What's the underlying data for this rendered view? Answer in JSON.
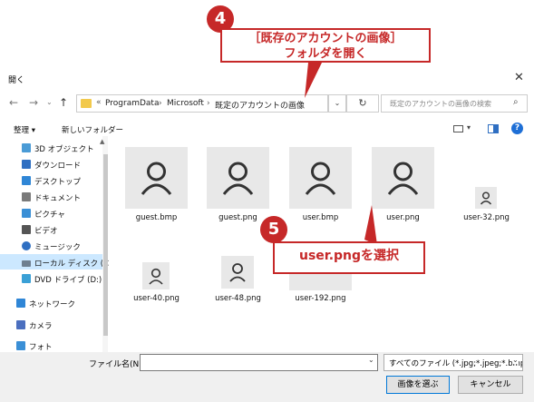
{
  "window": {
    "title": "開く"
  },
  "address": {
    "chevrons": "«",
    "segments": [
      "ProgramData",
      "Microsoft",
      "既定のアカウントの画像"
    ],
    "separator": "›"
  },
  "search": {
    "placeholder": "既定のアカウントの画像の検索"
  },
  "toolbar": {
    "organize": "整理 ▾",
    "new_folder": "新しいフォルダー"
  },
  "sidebar": {
    "items": [
      {
        "label": "3D オブジェクト",
        "icon": "cube-icon",
        "color": "#4a9bd6"
      },
      {
        "label": "ダウンロード",
        "icon": "download-icon",
        "color": "#2f6fc2"
      },
      {
        "label": "デスクトップ",
        "icon": "desktop-icon",
        "color": "#2f86d6"
      },
      {
        "label": "ドキュメント",
        "icon": "document-icon",
        "color": "#7a7a7a"
      },
      {
        "label": "ピクチャ",
        "icon": "pictures-icon",
        "color": "#3a8fd6"
      },
      {
        "label": "ビデオ",
        "icon": "video-icon",
        "color": "#555555"
      },
      {
        "label": "ミュージック",
        "icon": "music-icon",
        "color": "#2f6fc2"
      },
      {
        "label": "ローカル ディスク (C",
        "icon": "disk-icon",
        "color": "#6f7f8f"
      },
      {
        "label": "DVD ドライブ (D:)",
        "icon": "dvd-icon",
        "color": "#3aa0d6"
      },
      {
        "label": "ネットワーク",
        "icon": "network-icon",
        "color": "#2f86d6"
      },
      {
        "label": "カメラ",
        "icon": "camera-icon",
        "color": "#4b6fbf"
      },
      {
        "label": "フォト",
        "icon": "photo-icon",
        "color": "#3a8fd6"
      }
    ]
  },
  "files": [
    {
      "name": "guest.bmp"
    },
    {
      "name": "guest.png"
    },
    {
      "name": "user.bmp"
    },
    {
      "name": "user.png"
    },
    {
      "name": "user-32.png"
    },
    {
      "name": "user-40.png"
    },
    {
      "name": "user-48.png"
    },
    {
      "name": "user-192.png"
    }
  ],
  "bottom": {
    "filename_label": "ファイル名(N):",
    "filename_value": "",
    "filter": "すべてのファイル (*.jpg;*.jpeg;*.bmp",
    "select_button": "画像を選ぶ",
    "cancel_button": "キャンセル"
  },
  "callouts": {
    "step4_number": "4",
    "step4_line1": "［既存のアカウントの画像］",
    "step4_line2": "フォルダを開く",
    "step5_number": "5",
    "step5_text": "user.pngを選択"
  },
  "colors": {
    "accent": "#c62828",
    "folder": "#f2c94c",
    "tile": "#e8e8e8"
  }
}
